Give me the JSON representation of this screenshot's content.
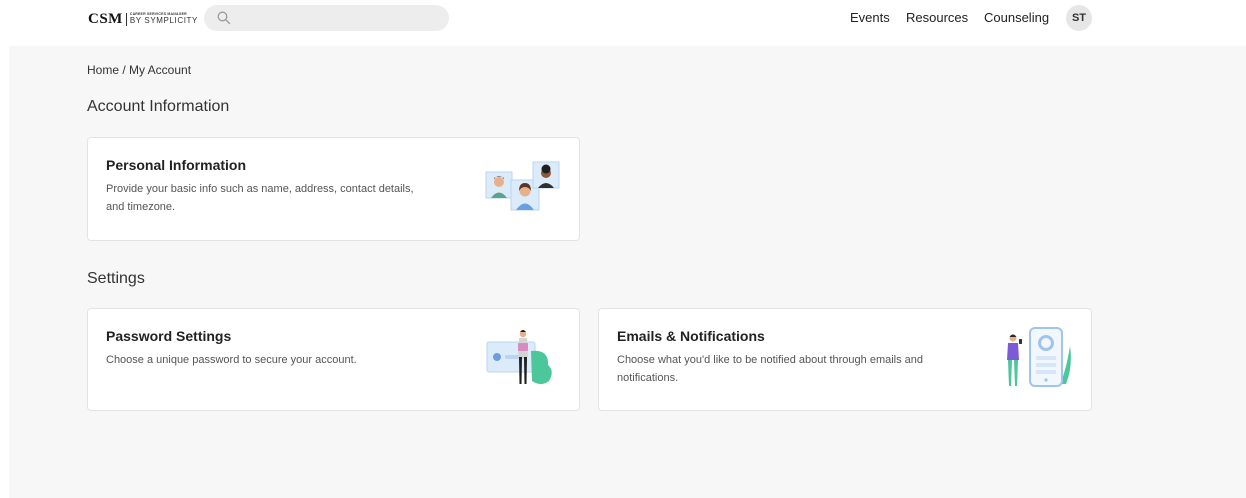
{
  "header": {
    "logo": {
      "main": "CSM",
      "sub_top": "CAREER SERVICES MANAGER",
      "sub_bottom": "BY SYMPLICITY"
    },
    "search": {
      "placeholder": "",
      "value": "",
      "icon": "search-icon"
    },
    "nav": [
      "Events",
      "Resources",
      "Counseling"
    ],
    "avatar_initials": "ST"
  },
  "breadcrumb": "Home / My Account",
  "sections": {
    "account": {
      "title": "Account Information",
      "cards": {
        "personal": {
          "title": "Personal Information",
          "desc_line1": "Provide your basic info such as name, address, contact details,",
          "desc_line2": "and timezone."
        }
      }
    },
    "settings": {
      "title": "Settings",
      "cards": {
        "password": {
          "title": "Password Settings",
          "desc_line1": "Choose a unique password to secure your account."
        },
        "emails": {
          "title": "Emails & Notifications",
          "desc_line1": "Choose what you'd like to be notified about through emails and",
          "desc_line2": "notifications."
        }
      }
    }
  },
  "colors": {
    "page_background": "#f7f7f7",
    "accent_green": "#4cc79b",
    "accent_blue": "#cfe3f7"
  }
}
